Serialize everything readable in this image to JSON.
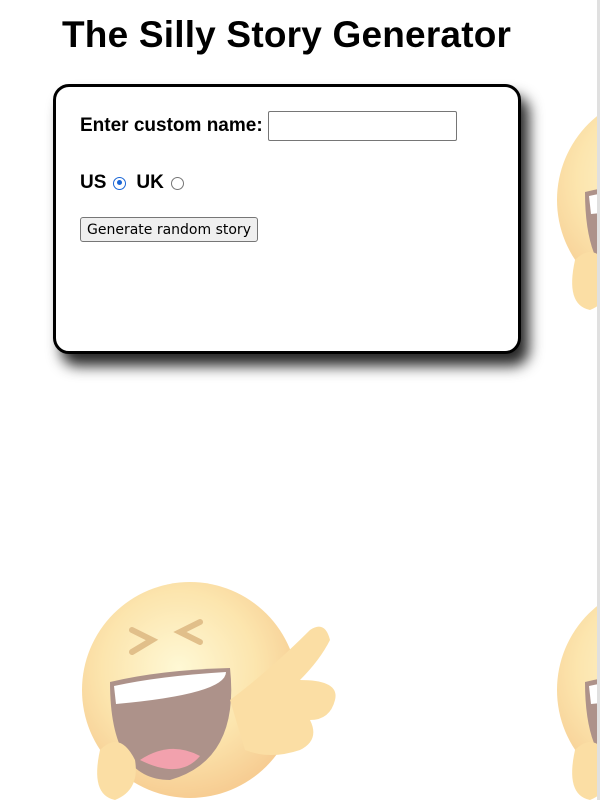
{
  "page": {
    "title": "The Silly Story Generator"
  },
  "form": {
    "name_label": "Enter custom name:",
    "name_value": "",
    "name_placeholder": "",
    "locale_options": [
      {
        "label": "US",
        "checked": true
      },
      {
        "label": "UK",
        "checked": false
      }
    ],
    "generate_label": "Generate random story"
  },
  "colors": {
    "radio_accent": "#1a66d6",
    "emoji_face": "#f6b73c",
    "emoji_highlight": "#fff2b0"
  },
  "icons": {
    "background": "laughing-pointing-emoji-icon"
  }
}
